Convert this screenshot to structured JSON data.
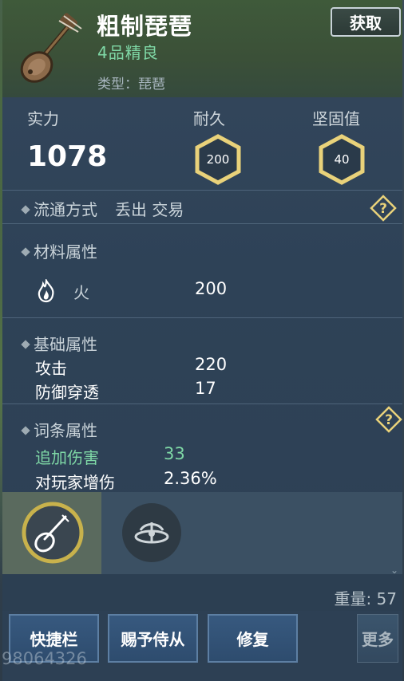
{
  "item": {
    "name": "粗制琵琶",
    "grade": "4品精良",
    "type": "类型：琵琶",
    "icon": "pipa-icon"
  },
  "header": {
    "obtain_label": "获取"
  },
  "stats": {
    "power_label": "实力",
    "power_value": "1078",
    "durability_label": "耐久",
    "durability_value": "200",
    "solidity_label": "坚固值",
    "solidity_value": "40",
    "hex_color": "#e9d27a"
  },
  "circulation": {
    "title": "流通方式",
    "value": "丢出 交易"
  },
  "material": {
    "title": "材料属性",
    "element_icon": "fire-icon",
    "element_label": "火",
    "element_value": "200"
  },
  "base": {
    "title": "基础属性",
    "rows": [
      {
        "label": "攻击",
        "value": "220"
      },
      {
        "label": "防御穿透",
        "value": "17"
      }
    ]
  },
  "affix": {
    "title": "词条属性",
    "rows": [
      {
        "label": "追加伤害",
        "value": "33"
      },
      {
        "label": "对玩家增伤",
        "value": "2.36%"
      }
    ]
  },
  "tabs": [
    {
      "icon": "pipa-icon",
      "active": true
    },
    {
      "icon": "spinning-weapon-icon",
      "active": false
    }
  ],
  "weight": "重量: 57",
  "buttons": {
    "shortcut": "快捷栏",
    "give": "赐予侍从",
    "repair": "修复",
    "more": "更多"
  },
  "watermark": "98064326",
  "colors": {
    "accent_green": "#7fd8a6",
    "hex_gold": "#e9d27a",
    "button_blue": "#2e4c6e"
  }
}
